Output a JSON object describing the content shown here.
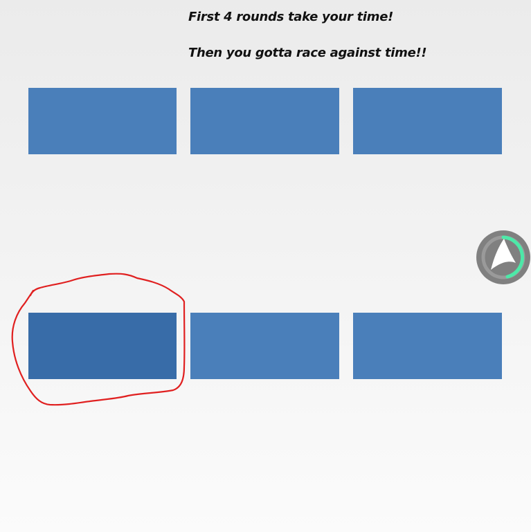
{
  "instructions": {
    "line1": "First 4 rounds take your time!",
    "line2": "Then you gotta race against time!!"
  },
  "tiles": {
    "count": 6,
    "color": "#4a7fba",
    "selected_color": "#386ca8",
    "selected_index": 4
  },
  "annotation": {
    "shape": "freehand-circle",
    "color": "#e02020",
    "target": "tile-4"
  },
  "widget": {
    "icon": "assistant-logo-icon",
    "ring_color": "#808080",
    "progress_color": "#4de8a8"
  }
}
